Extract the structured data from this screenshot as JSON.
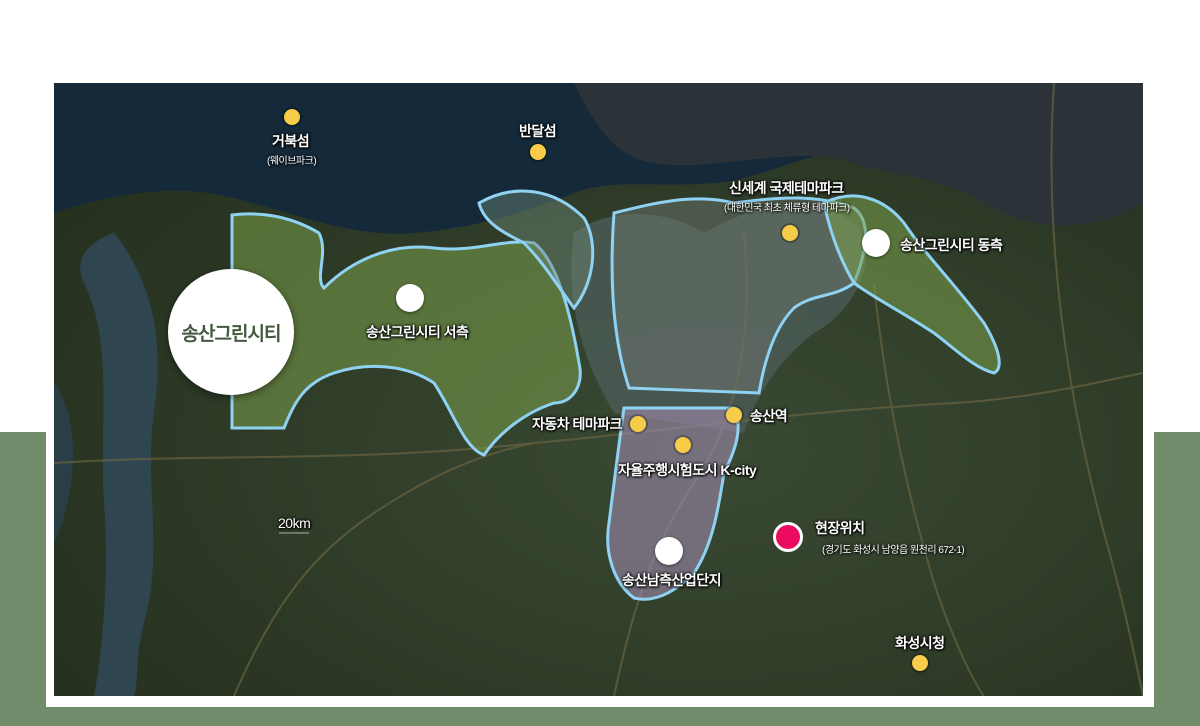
{
  "colors": {
    "band": "#718c6b",
    "zone_outline": "#8fd2f3",
    "marker_yellow": "#f6cc48",
    "site_marker": "#ea0a5e",
    "title_text": "#435a3e"
  },
  "map": {
    "title_badge": "송산그린시티",
    "places": {
      "geobukseom": {
        "label": "거북섬",
        "sub": "(웨이브파크)"
      },
      "bandalseom": {
        "label": "반달섬"
      },
      "shinsegae": {
        "label": "신세계 국제테마파크",
        "sub": "(대한민국 최초 체류형 테마파크)"
      },
      "green_east": {
        "label": "송산그린시티 동측"
      },
      "green_west": {
        "label": "송산그린시티 서측"
      },
      "auto_theme": {
        "label": "자동차 테마파크"
      },
      "songsan_station": {
        "label": "송산역"
      },
      "kcity": {
        "label": "자율주행시험도시 K-city"
      },
      "industrial": {
        "label": "송산남측산업단지"
      },
      "site": {
        "label": "현장위치",
        "sub": "(경기도 화성시 남양읍 원천리 672-1)"
      },
      "city_hall": {
        "label": "화성시청"
      },
      "distance": {
        "label": "20km"
      }
    }
  }
}
